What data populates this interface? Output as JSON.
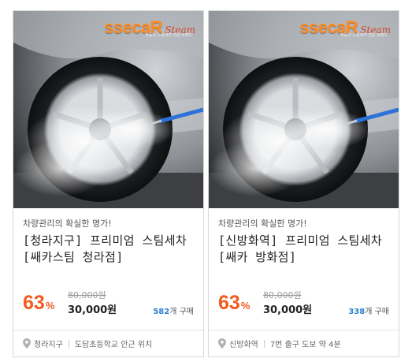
{
  "brand": {
    "logo_main": "ssecaR",
    "logo_script": "Steam",
    "logo_sub": "자동차 스팀세차 전문 브랜드"
  },
  "cards": [
    {
      "tagline": "차량관리의 확실한 명가!",
      "title": "[청라지구] 프리미엄 스팀세차[쌔카스팀 청라점]",
      "discount": "63",
      "discount_unit": "%",
      "original_price": "80,000원",
      "sale_price": "30,000원",
      "sold_count": "582",
      "sold_suffix": "개 구매",
      "location": "청라지구",
      "location_detail": "도담초등학교 안근 위치"
    },
    {
      "tagline": "차량관리의 확실한 명가!",
      "title": "[신방화역] 프리미엄 스팀세차[쌔카 방화점]",
      "discount": "63",
      "discount_unit": "%",
      "original_price": "80,000원",
      "sale_price": "30,000원",
      "sold_count": "338",
      "sold_suffix": "개 구매",
      "location": "신방화역",
      "location_detail": "7번 출구 도보 약 4분"
    }
  ],
  "colors": {
    "discount": "#f25a1e",
    "sold_count": "#2b7fd0",
    "logo": "#ff8a1e"
  },
  "icons": {
    "location": "map-pin-icon"
  }
}
